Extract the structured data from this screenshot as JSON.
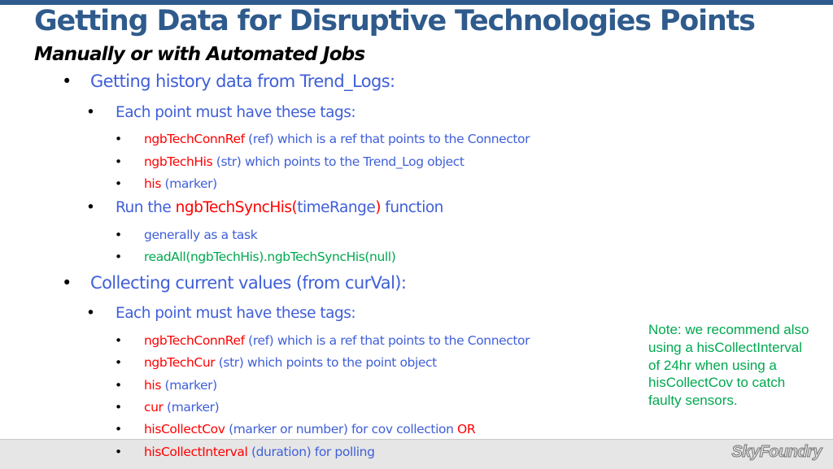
{
  "slide": {
    "title": "Getting Data for Disruptive Technologies Points",
    "subtitle": "Manually or with Automated Jobs",
    "note": "Note: we recommend also using a hisCollectInterval of 24hr when using a hisCollectCov to catch faulty sensors.",
    "logo": "SkyFoundry",
    "bullet_glyph": "•",
    "lines": [
      {
        "level": 1,
        "segments": [
          {
            "text": "Getting history data from Trend_Logs:",
            "color": "blue"
          }
        ]
      },
      {
        "level": 2,
        "segments": [
          {
            "text": "Each point must have these tags:",
            "color": "blue"
          }
        ]
      },
      {
        "level": 3,
        "segments": [
          {
            "text": "ngbTechConnRef",
            "color": "red"
          },
          {
            "text": " (ref) which is a ref that points to the Connector",
            "color": "blue"
          }
        ]
      },
      {
        "level": 3,
        "segments": [
          {
            "text": "ngbTechHis",
            "color": "red"
          },
          {
            "text": " (str) which points to the Trend_Log object",
            "color": "blue"
          }
        ]
      },
      {
        "level": 3,
        "segments": [
          {
            "text": "his",
            "color": "red"
          },
          {
            "text": " (marker)",
            "color": "blue"
          }
        ]
      },
      {
        "level": 2,
        "segments": [
          {
            "text": "Run the ",
            "color": "blue"
          },
          {
            "text": "ngbTechSyncHis(",
            "color": "red"
          },
          {
            "text": "timeRange",
            "color": "blue"
          },
          {
            "text": ")",
            "color": "red"
          },
          {
            "text": " function",
            "color": "blue"
          }
        ]
      },
      {
        "level": 3,
        "segments": [
          {
            "text": "generally as a task",
            "color": "blue"
          }
        ]
      },
      {
        "level": 3,
        "segments": [
          {
            "text": "readAll(ngbTechHis).ngbTechSyncHis(null)",
            "color": "green"
          }
        ]
      },
      {
        "level": 1,
        "segments": [
          {
            "text": "Collecting current values (from curVal):",
            "color": "blue"
          }
        ]
      },
      {
        "level": 2,
        "segments": [
          {
            "text": "Each point must have these tags:",
            "color": "blue"
          }
        ]
      },
      {
        "level": 3,
        "segments": [
          {
            "text": "ngbTechConnRef",
            "color": "red"
          },
          {
            "text": " (ref) which is a ref that points to the Connector",
            "color": "blue"
          }
        ]
      },
      {
        "level": 3,
        "segments": [
          {
            "text": "ngbTechCur",
            "color": "red"
          },
          {
            "text": " (str) which points to the point object",
            "color": "blue"
          }
        ]
      },
      {
        "level": 3,
        "segments": [
          {
            "text": "his",
            "color": "red"
          },
          {
            "text": " (marker)",
            "color": "blue"
          }
        ]
      },
      {
        "level": 3,
        "segments": [
          {
            "text": "cur",
            "color": "red"
          },
          {
            "text": " (marker)",
            "color": "blue"
          }
        ]
      },
      {
        "level": 3,
        "segments": [
          {
            "text": "hisCollectCov",
            "color": "red"
          },
          {
            "text": " (marker or number) for cov collection ",
            "color": "blue"
          },
          {
            "text": "OR",
            "color": "red"
          }
        ]
      },
      {
        "level": 3,
        "segments": [
          {
            "text": "hisCollectInterval",
            "color": "red"
          },
          {
            "text": " (duration) for polling",
            "color": "blue"
          }
        ]
      }
    ]
  },
  "colors": {
    "title": "#2f5b8c",
    "blue": "#3f5fd8",
    "red": "#ff0000",
    "green": "#00a84f",
    "footer": "#e6e6e6"
  }
}
